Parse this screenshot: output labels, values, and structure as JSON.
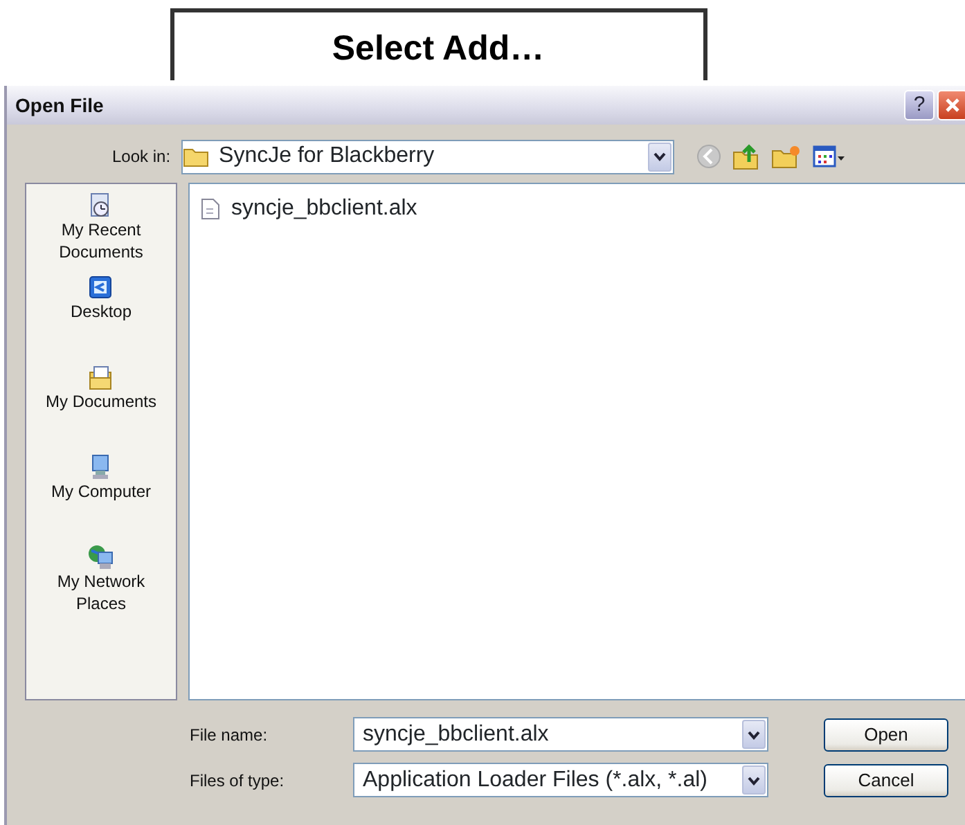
{
  "callout": {
    "text": "Select Add…"
  },
  "window": {
    "title": "Open File",
    "help": "?"
  },
  "look_in": {
    "label": "Look in:",
    "value": "SyncJe for Blackberry"
  },
  "places": [
    {
      "kind": "recent",
      "label": "My Recent Documents"
    },
    {
      "kind": "desktop",
      "label": "Desktop"
    },
    {
      "kind": "documents",
      "label": "My Documents"
    },
    {
      "kind": "computer",
      "label": "My Computer"
    },
    {
      "kind": "network",
      "label": "My Network Places"
    }
  ],
  "files": [
    {
      "name": "syncje_bbclient.alx"
    }
  ],
  "file_name": {
    "label": "File name:",
    "value": "syncje_bbclient.alx"
  },
  "file_type": {
    "label": "Files of type:",
    "value": "Application Loader Files (*.alx, *.al)"
  },
  "buttons": [
    "Open",
    "Cancel"
  ]
}
